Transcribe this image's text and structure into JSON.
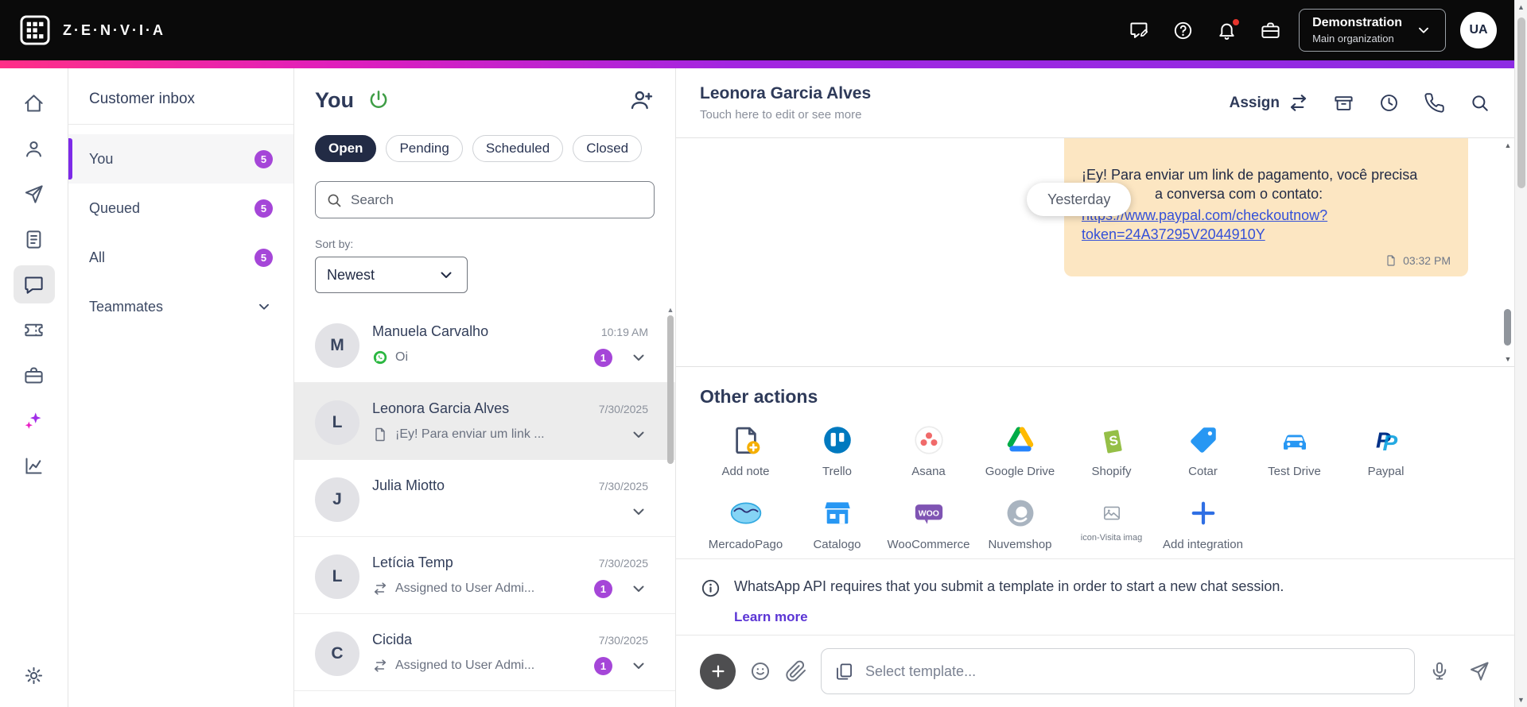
{
  "theme": {
    "accent": "#7d2ae8",
    "badge": "#a546d8",
    "tab-active": "#222b45",
    "bubble": "#fce6c2",
    "link": "#3450d8",
    "power": "#3f9d46",
    "learn-link": "#5b35d5",
    "whatsapp-green": "#2bb741",
    "notification-red": "#e5342c"
  },
  "topbar": {
    "brand": "Z·E·N·V·I·A",
    "icons": [
      "chat-edit-icon",
      "help-icon",
      "notifications-icon",
      "briefcase-icon"
    ],
    "org": {
      "name": "Demonstration",
      "sub": "Main organization"
    },
    "avatar": "UA"
  },
  "rail": {
    "items": [
      "home-icon",
      "contacts-icon",
      "send-icon",
      "docs-icon",
      "chat-icon",
      "ticket-icon",
      "toolbox-icon",
      "ai-sparkles-icon",
      "analytics-icon"
    ],
    "bottom": "settings-icon",
    "active": "chat-icon"
  },
  "inbox_sidebar": {
    "title": "Customer inbox",
    "items": [
      {
        "label": "You",
        "badge": "5",
        "selected": true
      },
      {
        "label": "Queued",
        "badge": "5"
      },
      {
        "label": "All",
        "badge": "5"
      },
      {
        "label": "Teammates",
        "chevron": true
      }
    ]
  },
  "conversation_list": {
    "title": "You",
    "tabs": [
      {
        "label": "Open",
        "active": true
      },
      {
        "label": "Pending"
      },
      {
        "label": "Scheduled"
      },
      {
        "label": "Closed"
      }
    ],
    "search_placeholder": "Search",
    "sort_label": "Sort by:",
    "sort_value": "Newest",
    "conversations": [
      {
        "initial": "M",
        "name": "Manuela Carvalho",
        "time": "10:19 AM",
        "preview": "Oi",
        "preview_icon": "whatsapp-icon",
        "badge": "1"
      },
      {
        "initial": "L",
        "name": "Leonora Garcia Alves",
        "time": "7/30/2025",
        "preview": "¡Ey! Para enviar um link ...",
        "preview_icon": "template-icon",
        "selected": true
      },
      {
        "initial": "J",
        "name": "Julia Miotto",
        "time": "7/30/2025"
      },
      {
        "initial": "L",
        "name": "Letícia Temp",
        "time": "7/30/2025",
        "preview": "Assigned to User Admi...",
        "preview_icon": "transfer-icon",
        "badge": "1"
      },
      {
        "initial": "C",
        "name": "Cicida",
        "time": "7/30/2025",
        "preview": "Assigned to User Admi...",
        "preview_icon": "transfer-icon",
        "badge": "1"
      }
    ]
  },
  "chat": {
    "header": {
      "name": "Leonora Garcia Alves",
      "subtitle": "Touch here to edit or see more",
      "assign_label": "Assign",
      "icons": [
        "transfer-icon",
        "archive-icon",
        "history-icon",
        "phone-icon",
        "search-icon"
      ]
    },
    "date_pill": "Yesterday",
    "message": {
      "line1": "¡Ey! Para enviar um link de pagamento, você precisa",
      "line2": "a conversa com o contato:",
      "link_line1": "https://www.paypal.com/checkoutnow?",
      "link_line2": "token=24A37295V2044910Y",
      "time": "03:32 PM"
    },
    "other_actions": {
      "title": "Other actions",
      "row1": [
        {
          "icon": "add-note-icon",
          "label": "Add note"
        },
        {
          "icon": "trello-icon",
          "label": "Trello"
        },
        {
          "icon": "asana-icon",
          "label": "Asana"
        },
        {
          "icon": "google-drive-icon",
          "label": "Google Drive"
        },
        {
          "icon": "shopify-icon",
          "label": "Shopify"
        },
        {
          "icon": "price-tag-icon",
          "label": "Cotar"
        },
        {
          "icon": "car-icon",
          "label": "Test Drive"
        },
        {
          "icon": "paypal-icon",
          "label": "Paypal"
        }
      ],
      "row2": [
        {
          "icon": "mercadopago-icon",
          "label": "MercadoPago"
        },
        {
          "icon": "storefront-icon",
          "label": "Catalogo"
        },
        {
          "icon": "woocommerce-icon",
          "label": "WooCommerce"
        },
        {
          "icon": "nuvemshop-icon",
          "label": "Nuvemshop"
        },
        {
          "icon": "broken-image-icon",
          "label": "icon-Visita imag"
        },
        {
          "icon": "add-integration-icon",
          "label": "Add integration"
        }
      ]
    },
    "banner": {
      "text": "WhatsApp API requires that you submit a template in order to start a new chat session.",
      "link": "Learn more"
    },
    "composer": {
      "placeholder": "Select template..."
    }
  }
}
